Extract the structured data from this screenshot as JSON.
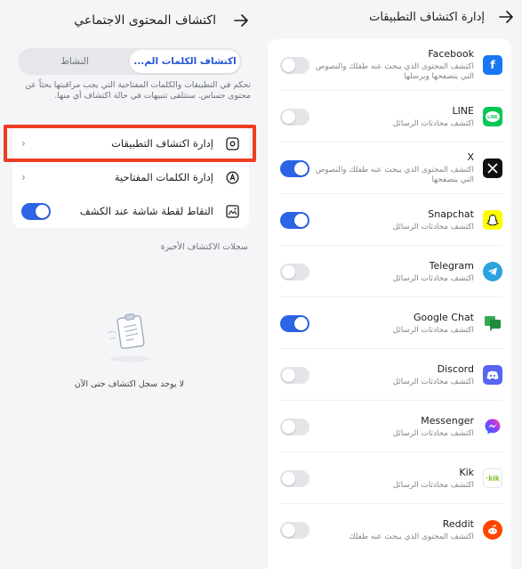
{
  "left": {
    "header_title": "اكتشاف المحتوى الاجتماعي",
    "tabs": [
      {
        "label": "اكتشاف الكلمات الم...",
        "active": true
      },
      {
        "label": "النشاط",
        "active": false
      }
    ],
    "description": "تحكم في التطبيقات والكلمات المفتاحية التي يجب مراقبتها بحثاً عن محتوى حساس. ستتلقى تنبيهات في حالة اكتشاف أي منها.",
    "menu": [
      {
        "label": "إدارة اكتشاف التطبيقات",
        "icon": "gear-app-icon"
      },
      {
        "label": "إدارة الكلمات المفتاحية",
        "icon": "keyword-a-icon"
      },
      {
        "label": "التقاط لقطة شاشة عند الكشف",
        "icon": "screenshot-icon",
        "toggle": true
      }
    ],
    "recent_title": "سجلات الاكتشاف الأخيرة",
    "empty_text": "لا يوجد سجل اكتشاف حتى الآن"
  },
  "right": {
    "header_title": "إدارة اكتشاف التطبيقات",
    "apps": [
      {
        "name": "Facebook",
        "desc": "اكتشف المحتوى الذي يبحث عنه طفلك والنصوص التي يتصفحها ويرسلها",
        "enabled": false,
        "icon": "facebook-icon",
        "color": "#1877f2"
      },
      {
        "name": "LINE",
        "desc": "اكتشف محادثات الرسائل",
        "enabled": false,
        "icon": "line-icon",
        "color": "#06c755"
      },
      {
        "name": "X",
        "desc": "اكتشف المحتوى الذي يبحث عنه طفلك والنصوص التي يتصفحها",
        "enabled": true,
        "icon": "x-icon",
        "color": "#111111"
      },
      {
        "name": "Snapchat",
        "desc": "اكتشف محادثات الرسائل",
        "enabled": true,
        "icon": "snapchat-icon",
        "color": "#fffc00"
      },
      {
        "name": "Telegram",
        "desc": "اكتشف محادثات الرسائل",
        "enabled": false,
        "icon": "telegram-icon",
        "color": "#2aa3df"
      },
      {
        "name": "Google Chat",
        "desc": "اكتشف محادثات الرسائل",
        "enabled": true,
        "icon": "google-chat-icon",
        "color": "#1e8e3e"
      },
      {
        "name": "Discord",
        "desc": "اكتشف محادثات الرسائل",
        "enabled": false,
        "icon": "discord-icon",
        "color": "#5865f2"
      },
      {
        "name": "Messenger",
        "desc": "اكتشف محادثات الرسائل",
        "enabled": false,
        "icon": "messenger-icon",
        "color": "#a334fa"
      },
      {
        "name": "Kik",
        "desc": "اكتشف محادثات الرسائل",
        "enabled": false,
        "icon": "kik-icon",
        "color": "#82bc23"
      },
      {
        "name": "Reddit",
        "desc": "اكتشف المحتوى الذي يبحث عنه طفلك",
        "enabled": false,
        "icon": "reddit-icon",
        "color": "#ff4500"
      }
    ]
  },
  "colors": {
    "accent": "#2d64e6",
    "highlight": "#ee3d24",
    "background": "#f4f5f7"
  }
}
